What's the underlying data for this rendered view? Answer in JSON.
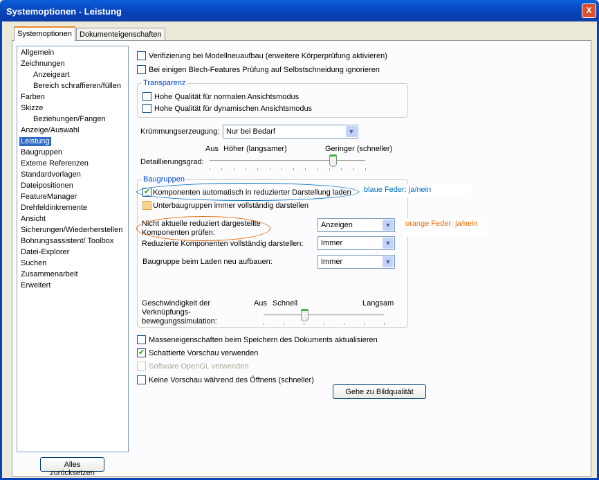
{
  "window": {
    "title": "Systemoptionen - Leistung",
    "close": "X"
  },
  "tabs": [
    {
      "label": "Systemoptionen",
      "active": true
    },
    {
      "label": "Dokumenteigenschaften",
      "active": false
    }
  ],
  "tree": [
    {
      "label": "Allgemein",
      "level": 0
    },
    {
      "label": "Zeichnungen",
      "level": 0
    },
    {
      "label": "Anzeigeart",
      "level": 1
    },
    {
      "label": "Bereich schraffieren/füllen",
      "level": 1
    },
    {
      "label": "Farben",
      "level": 0
    },
    {
      "label": "Skizze",
      "level": 0
    },
    {
      "label": "Beziehungen/Fangen",
      "level": 1
    },
    {
      "label": "Anzeige/Auswahl",
      "level": 0
    },
    {
      "label": "Leistung",
      "level": 0,
      "selected": true
    },
    {
      "label": "Baugruppen",
      "level": 0
    },
    {
      "label": "Externe Referenzen",
      "level": 0
    },
    {
      "label": "Standardvorlagen",
      "level": 0
    },
    {
      "label": "Dateipositionen",
      "level": 0
    },
    {
      "label": "FeatureManager",
      "level": 0
    },
    {
      "label": "Drehfeldinkremente",
      "level": 0
    },
    {
      "label": "Ansicht",
      "level": 0
    },
    {
      "label": "Sicherungen/Wiederherstellen",
      "level": 0
    },
    {
      "label": "Bohrungsassistent/ Toolbox",
      "level": 0
    },
    {
      "label": "Datei-Explorer",
      "level": 0
    },
    {
      "label": "Suchen",
      "level": 0
    },
    {
      "label": "Zusammenarbeit",
      "level": 0
    },
    {
      "label": "Erweitert",
      "level": 0
    }
  ],
  "reset_button": "Alles zurücksetzen",
  "options": {
    "verify": "Verifizierung bei Modellneuaufbau (erweitere Körperprüfung aktivieren)",
    "sheetmetal": "Bei einigen Blech-Features Prüfung auf Selbstschneidung ignorieren",
    "transparency": {
      "legend": "Transparenz",
      "normal": "Hohe Qualität für normalen Ansichtsmodus",
      "dynamic": "Hohe Qualität für dynamischen Ansichtsmodus"
    },
    "curvature": {
      "label": "Krümmungserzeugung:",
      "value": "Nur bei Bedarf"
    },
    "detail": {
      "label": "Detaillierungsgrad:",
      "off": "Aus",
      "high": "Höher (langsamer)",
      "low": "Geringer (schneller)",
      "level_fraction": 0.79
    },
    "assemblies": {
      "legend": "Baugruppen",
      "lightweight": "Komponenten automatisch in reduzierter Darstellung laden",
      "subassemblies": "Unterbaugruppen immer vollständig darstellen",
      "check_label": "Nicht aktuelle reduziert dargestellte Komponenten prüfen:",
      "check_value": "Anzeigen",
      "resolve_label": "Reduzierte Komponenten vollständig darstellen:",
      "resolve_value": "Immer",
      "rebuild_label": "Baugruppe beim Laden neu aufbauen:",
      "rebuild_value": "Immer",
      "speed_label": "Geschwindigkeit der Verknüpfungs-bewegungssimulation:",
      "speed_off": "Aus",
      "speed_fast": "Schnell",
      "speed_slow": "Langsam",
      "speed_fraction": 0.34
    },
    "mass": "Masseneigenschaften beim Speichern des Dokuments aktualisieren",
    "shaded": "Schattierte Vorschau verwenden",
    "opengl": "Software OpenGL verwenden",
    "nopreview": "Keine Vorschau während des Öffnens (schneller)",
    "image_quality": "Gehe zu Bildqualität"
  },
  "annotations": {
    "blue": "blaue Feder: ja/nein",
    "orange": "orange Feder: ja/nein",
    "blue_color": "#0070c0",
    "orange_color": "#e46c0a"
  }
}
